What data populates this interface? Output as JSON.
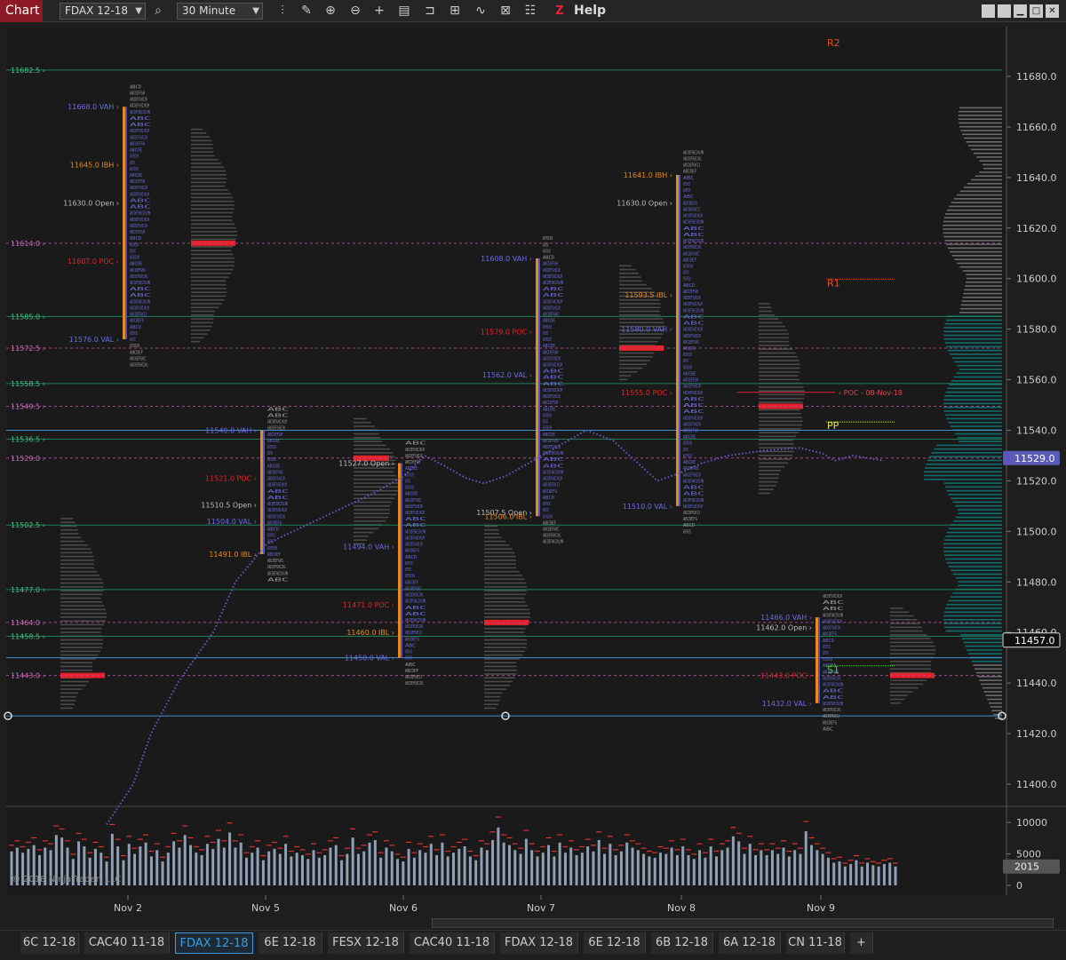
{
  "toolbar": {
    "chart_tab": "Chart",
    "instrument": "FDAX 12-18",
    "interval": "30 Minute",
    "help": "Help",
    "z_label": "Z"
  },
  "copyright": "© 2018 NinjaTrader, LLC",
  "chart_data": {
    "type": "market-profile",
    "price_axis": {
      "min": 11395,
      "max": 11690,
      "ticks": [
        11400,
        11420,
        11440,
        11460,
        11480,
        11500,
        11520,
        11540,
        11560,
        11580,
        11600,
        11620,
        11640,
        11660,
        11680
      ]
    },
    "volume_axis": {
      "ticks": [
        "10000",
        "5000",
        "0"
      ],
      "max": 11000
    },
    "x_labels": [
      "Nov 2",
      "Nov 5",
      "Nov 6",
      "Nov 7",
      "Nov 8",
      "Nov 9"
    ],
    "current_price": "11529.0",
    "marker_price": "11457.0",
    "marker_price_value": 11457.0,
    "current_price_value": 11529.0,
    "last_volume": "2015",
    "pivots": [
      {
        "name": "R2",
        "price": 11692
      },
      {
        "name": "R1",
        "price": 11597
      },
      {
        "name": "PP",
        "price": 11540.5
      },
      {
        "name": "S1",
        "price": 11444
      }
    ],
    "horizontal_levels": [
      {
        "label": "11682.5",
        "price": 11682.5,
        "color": "#1e8a5a",
        "style": "solid"
      },
      {
        "label": "11614.0",
        "price": 11614.0,
        "color": "#b04a9a",
        "style": "dashed"
      },
      {
        "label": "11585.0",
        "price": 11585.0,
        "color": "#1e8a5a",
        "style": "solid"
      },
      {
        "label": "11572.5",
        "price": 11572.5,
        "color": "#b04a9a",
        "style": "dashed"
      },
      {
        "label": "11558.5",
        "price": 11558.5,
        "color": "#1e8a5a",
        "style": "solid"
      },
      {
        "label": "11549.5",
        "price": 11549.5,
        "color": "#b04a9a",
        "style": "dashed"
      },
      {
        "label": "",
        "price": 11540.0,
        "color": "#4a9ae0",
        "style": "solid"
      },
      {
        "label": "11536.5",
        "price": 11536.5,
        "color": "#1e8a5a",
        "style": "solid"
      },
      {
        "label": "11529.0",
        "price": 11529.0,
        "color": "#b04a9a",
        "style": "dashed"
      },
      {
        "label": "11502.5",
        "price": 11502.5,
        "color": "#1e8a5a",
        "style": "solid"
      },
      {
        "label": "11477.0",
        "price": 11477.0,
        "color": "#1e8a5a",
        "style": "solid"
      },
      {
        "label": "11464.0",
        "price": 11464.0,
        "color": "#b04a9a",
        "style": "dashed"
      },
      {
        "label": "11458.5",
        "price": 11458.5,
        "color": "#1e8a5a",
        "style": "solid"
      },
      {
        "label": "",
        "price": 11450.0,
        "color": "#4a9ae0",
        "style": "solid"
      },
      {
        "label": "11443.0",
        "price": 11443.0,
        "color": "#b04a9a",
        "style": "dashed"
      },
      {
        "label": "",
        "price": 11427.0,
        "color": "#4a9ae0",
        "style": "solid"
      }
    ],
    "sessions": [
      {
        "date": "Nov 2",
        "labels": [
          {
            "text": "11668.0 VAH",
            "price": 11668.0,
            "kind": "vah"
          },
          {
            "text": "11645.0 IBH",
            "price": 11645.0,
            "kind": "ib"
          },
          {
            "text": "11630.0 Open",
            "price": 11630.0,
            "kind": "open"
          },
          {
            "text": "11607.0 POC",
            "price": 11607.0,
            "kind": "poc"
          },
          {
            "text": "11576.0 VAL",
            "price": 11576.0,
            "kind": "val"
          }
        ]
      },
      {
        "date": "Nov 5",
        "labels": [
          {
            "text": "11540.0 VAH",
            "price": 11540.0,
            "kind": "vah"
          },
          {
            "text": "11521.0 POC",
            "price": 11521.0,
            "kind": "poc"
          },
          {
            "text": "11510.5 Open",
            "price": 11510.5,
            "kind": "open"
          },
          {
            "text": "11504.0 VAL",
            "price": 11504.0,
            "kind": "val"
          },
          {
            "text": "11491.0 IBL",
            "price": 11491.0,
            "kind": "ib"
          }
        ]
      },
      {
        "date": "Nov 6",
        "labels": [
          {
            "text": "11527.0 Open",
            "price": 11527.0,
            "kind": "open"
          },
          {
            "text": "11494.0 VAH",
            "price": 11494.0,
            "kind": "vah"
          },
          {
            "text": "11471.0 POC",
            "price": 11471.0,
            "kind": "poc"
          },
          {
            "text": "11460.0 IBL",
            "price": 11460.0,
            "kind": "ib"
          },
          {
            "text": "11450.0 VAL",
            "price": 11450.0,
            "kind": "val"
          }
        ]
      },
      {
        "date": "Nov 7",
        "labels": [
          {
            "text": "11608.0 VAH",
            "price": 11608.0,
            "kind": "vah"
          },
          {
            "text": "11579.0 POC",
            "price": 11579.0,
            "kind": "poc"
          },
          {
            "text": "11562.0 VAL",
            "price": 11562.0,
            "kind": "val"
          },
          {
            "text": "11507.5 Open",
            "price": 11507.5,
            "kind": "open"
          },
          {
            "text": "11506.0 IBL",
            "price": 11506.0,
            "kind": "ib"
          }
        ]
      },
      {
        "date": "Nov 8",
        "labels": [
          {
            "text": "11641.0 IBH",
            "price": 11641.0,
            "kind": "ib"
          },
          {
            "text": "11630.0 Open",
            "price": 11630.0,
            "kind": "open"
          },
          {
            "text": "11593.5 IBL",
            "price": 11593.5,
            "kind": "ib"
          },
          {
            "text": "11580.0 VAH",
            "price": 11580.0,
            "kind": "vah"
          },
          {
            "text": "11555.0 POC",
            "price": 11555.0,
            "kind": "poc"
          },
          {
            "text": "11510.0 VAL",
            "price": 11510.0,
            "kind": "val"
          }
        ]
      },
      {
        "date": "Nov 9",
        "labels": [
          {
            "text": "11466.0 VAH",
            "price": 11466.0,
            "kind": "vah"
          },
          {
            "text": "11462.0 Open",
            "price": 11462.0,
            "kind": "open"
          },
          {
            "text": "11443.0 POC",
            "price": 11443.0,
            "kind": "poc"
          },
          {
            "text": "11432.0 VAL",
            "price": 11432.0,
            "kind": "val"
          }
        ]
      }
    ],
    "poc_annotation": "POC - 08-Nov-18",
    "poc_annotation_price": 11555.0,
    "vwap": [
      [
        11384,
        120
      ],
      [
        11400,
        150
      ],
      [
        11420,
        170
      ],
      [
        11440,
        200
      ],
      [
        11460,
        240
      ],
      [
        11480,
        265
      ],
      [
        11495,
        300
      ],
      [
        11505,
        360
      ],
      [
        11515,
        420
      ],
      [
        11522,
        455
      ],
      [
        11530,
        478
      ],
      [
        11526,
        500
      ],
      [
        11521,
        525
      ],
      [
        11519,
        545
      ],
      [
        11522,
        570
      ],
      [
        11528,
        600
      ],
      [
        11536,
        640
      ],
      [
        11540,
        660
      ],
      [
        11536,
        690
      ],
      [
        11528,
        715
      ],
      [
        11520,
        740
      ],
      [
        11523,
        765
      ],
      [
        11527,
        790
      ],
      [
        11530,
        820
      ],
      [
        11532,
        860
      ],
      [
        11533,
        900
      ],
      [
        11531,
        925
      ],
      [
        11528,
        940
      ],
      [
        11530,
        960
      ],
      [
        11528,
        995
      ]
    ],
    "volume_bars": [
      5400,
      6000,
      5200,
      5800,
      6400,
      4800,
      6000,
      5600,
      8000,
      7600,
      6000,
      4200,
      7000,
      6200,
      4400,
      5800,
      5200,
      3800,
      8200,
      6200,
      4000,
      6600,
      5000,
      6200,
      6800,
      4600,
      5600,
      3800,
      5200,
      7000,
      6000,
      8000,
      6400,
      5200,
      4800,
      6600,
      5800,
      7400,
      6000,
      8400,
      6000,
      6800,
      4400,
      5200,
      6000,
      4000,
      5400,
      5800,
      5000,
      6600,
      4600,
      5200,
      4800,
      4200,
      5600,
      4400,
      4800,
      6000,
      6400,
      4000,
      5000,
      7600,
      5000,
      5400,
      6800,
      7200,
      4400,
      6000,
      5400,
      4200,
      3800,
      5800,
      4400,
      5600,
      5200,
      6600,
      4800,
      6800,
      4600,
      5200,
      5800,
      6200,
      4600,
      4000,
      6000,
      5600,
      7200,
      9200,
      6800,
      6400,
      5600,
      5000,
      7400,
      5600,
      4600,
      5200,
      6400,
      4600,
      6800,
      5200,
      6000,
      4800,
      5200,
      6200,
      5400,
      7200,
      5000,
      6600,
      4800,
      5400,
      6800,
      6000,
      5600,
      5000,
      4600,
      4400,
      5200,
      5000,
      6000,
      4800,
      6200,
      4800,
      4200,
      5600,
      4400,
      6200,
      4600,
      5600,
      6000,
      7800,
      7000,
      5000,
      6600,
      4800,
      5600,
      4800,
      5600,
      5000,
      6000,
      4600,
      5600,
      5000,
      8600,
      6400,
      5600,
      5000,
      4400,
      3600,
      3800,
      3000,
      3400,
      4000,
      3000,
      3600,
      3200,
      3000,
      3400,
      3600,
      3000
    ]
  },
  "instrument_tabs": [
    {
      "label": "6C 12-18"
    },
    {
      "label": "CAC40 11-18"
    },
    {
      "label": "FDAX 12-18"
    },
    {
      "label": "6E 12-18"
    },
    {
      "label": "FESX 12-18"
    },
    {
      "label": "CAC40 11-18"
    },
    {
      "label": "FDAX 12-18"
    },
    {
      "label": "6E 12-18"
    },
    {
      "label": "6B 12-18"
    },
    {
      "label": "6A 12-18"
    },
    {
      "label": "CN 11-18"
    },
    {
      "label": "+"
    }
  ],
  "active_tab_index": 2,
  "colors": {
    "poc": "#e52229",
    "vah_val": "#5a5ad8",
    "ib": "#e8891a",
    "open": "#bbbbbb",
    "vwap": "#6a58c8",
    "profile_teal": "#0e6e6e"
  }
}
